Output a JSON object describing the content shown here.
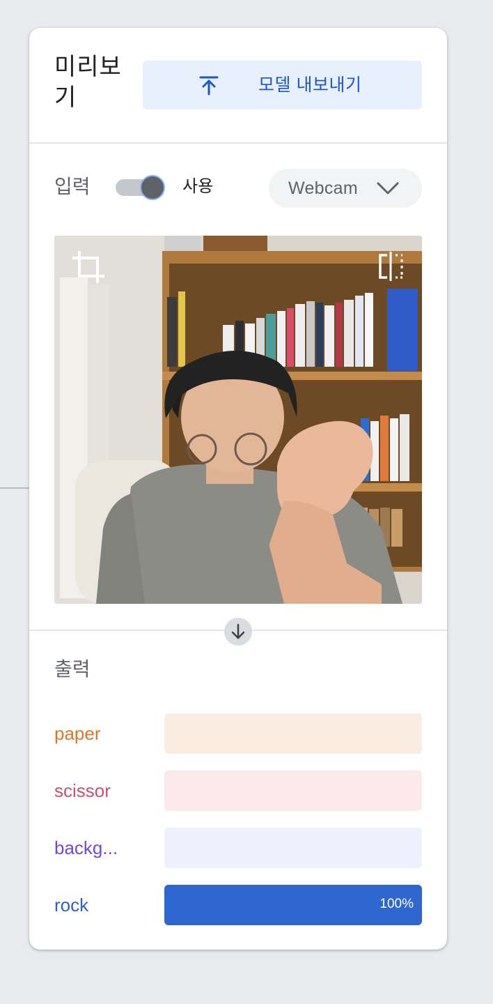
{
  "header": {
    "title": "미리보기",
    "export_button_label": "모델 내보내기",
    "export_icon": "upload-arrow-icon"
  },
  "input": {
    "label": "입력",
    "toggle_state": "on",
    "toggle_label": "사용",
    "source_selected": "Webcam",
    "crop_icon": "crop-icon",
    "flip_icon": "flip-horizontal-icon"
  },
  "output": {
    "label": "출력",
    "classes": [
      {
        "name": "paper",
        "value": 0,
        "pct_label": "",
        "color": "#d9782a",
        "track_color": "#fbece1",
        "fill_color": "#e8710a"
      },
      {
        "name": "scissor",
        "value": 0,
        "pct_label": "",
        "color": "#c9506f",
        "track_color": "#fbe9eb",
        "fill_color": "#d93025"
      },
      {
        "name": "backg...",
        "value": 0,
        "pct_label": "",
        "color": "#7248d6",
        "track_color": "#eff0fd",
        "fill_color": "#7b61ff"
      },
      {
        "name": "rock",
        "value": 1.0,
        "pct_label": "100%",
        "color": "#2a62c9",
        "track_color": "#e3ebfb",
        "fill_color": "#2f66d0"
      }
    ]
  },
  "colors": {
    "accent": "#1a57c9",
    "export_bg": "#e8f0fe"
  }
}
